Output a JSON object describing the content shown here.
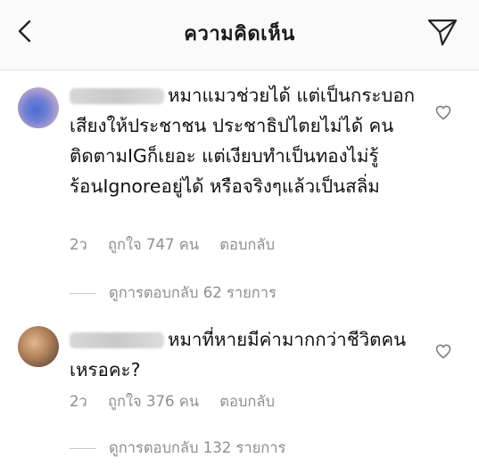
{
  "header": {
    "title": "ความคิดเห็น"
  },
  "comments": [
    {
      "text": "หมาแมวช่วยได้ แต่เป็นกระบอกเสียงให้ประชาชน ประชาธิปไตยไม่ได้ คนติดตามIGก็เยอะ แต่เงียบทำเป็นทองไม่รู้ร้อนIgnoreอยู่ได้ หรือจริงๆแล้วเป็นสลิ่ม",
      "time": "2ว",
      "likes": "ถูกใจ 747 คน",
      "reply_label": "ตอบกลับ",
      "view_replies": "ดูการตอบกลับ 62 รายการ"
    },
    {
      "text": "หมาที่หายมีค่ามากกว่าชีวิตคนเหรอคะ?",
      "time": "2ว",
      "likes": "ถูกใจ 376 คน",
      "reply_label": "ตอบกลับ",
      "view_replies": "ดูการตอบกลับ 132 รายการ"
    }
  ]
}
